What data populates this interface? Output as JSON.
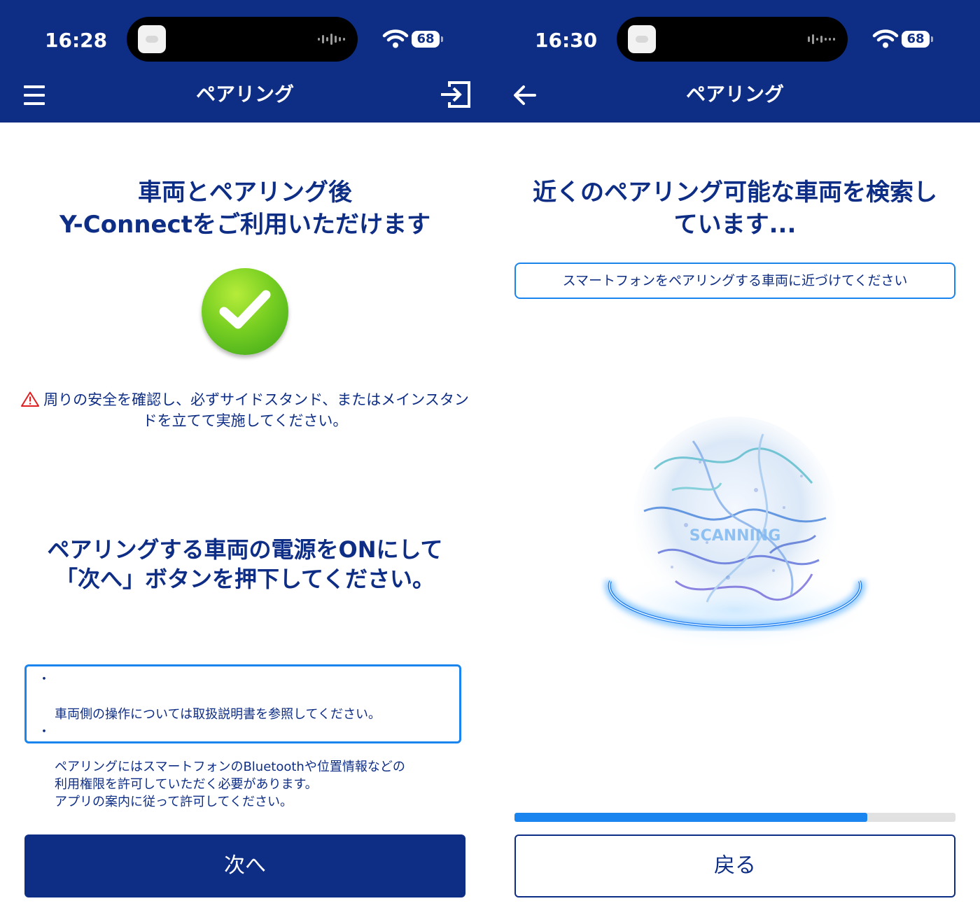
{
  "left_screen": {
    "status_bar": {
      "time": "16:28",
      "battery": "68"
    },
    "nav": {
      "title": "ペアリング",
      "menu_icon": "hamburger-menu-icon",
      "action_icon": "logout-icon"
    },
    "heading": "車両とペアリング後\nY-Connectをご利用いただけます",
    "check_icon": "success-check-icon",
    "warning": {
      "icon": "warning-triangle-icon",
      "text": "周りの安全を確認し、必ずサイドスタンド、またはメインスタンドを立てて実施してください。"
    },
    "instruction": "ペアリングする車両の電源をONにして\n「次へ」ボタンを押下してください。",
    "notes": [
      {
        "bullet": "・",
        "text": "車両側の操作については取扱説明書を参照してください。"
      },
      {
        "bullet": "・",
        "text": "ペアリングにはスマートフォンのBluetoothや位置情報などの\n利用権限を許可していただく必要があります。\nアプリの案内に従って許可してください。"
      }
    ],
    "next_button": "次へ"
  },
  "right_screen": {
    "status_bar": {
      "time": "16:30",
      "battery": "68"
    },
    "nav": {
      "title": "ペアリング",
      "back_icon": "back-arrow-icon"
    },
    "heading": "近くのペアリング可能な車両を検索し\nています...",
    "hint": "スマートフォンをペアリングする車両に近づけてください",
    "scan_label": "SCANNING",
    "progress_percent": 80,
    "back_button": "戻る"
  },
  "colors": {
    "brand_navy": "#0e2d85",
    "accent_blue": "#1a85ee",
    "success_green": "#5cc020",
    "warning_red": "#e02020"
  }
}
